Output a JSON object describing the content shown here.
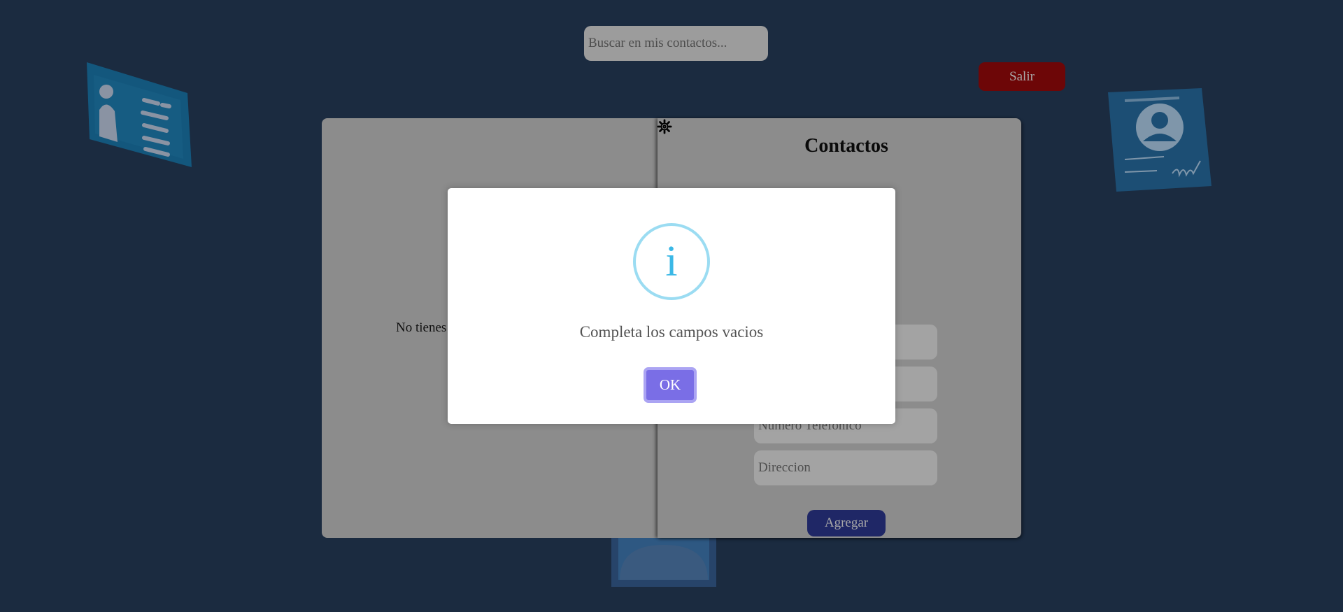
{
  "search": {
    "placeholder": "Buscar en mis contactos..."
  },
  "header": {
    "logout_label": "Salir"
  },
  "left_page": {
    "empty_message": "No tienes"
  },
  "right_page": {
    "title": "Contactos",
    "fields": [
      {
        "placeholder": ""
      },
      {
        "placeholder": ""
      },
      {
        "placeholder": "Numero Telefonico"
      },
      {
        "placeholder": "Direccion"
      }
    ],
    "add_label": "Agregar",
    "settings_icon": "gear-icon"
  },
  "modal": {
    "icon": "info-icon",
    "icon_glyph": "i",
    "message": "Completa los campos vacios",
    "ok_label": "OK"
  },
  "colors": {
    "background": "#1b2b40",
    "logout": "#6d0607",
    "add_button": "#1f2766",
    "ok_button": "#7a6ee6",
    "info_icon": "#3bb8e6"
  }
}
